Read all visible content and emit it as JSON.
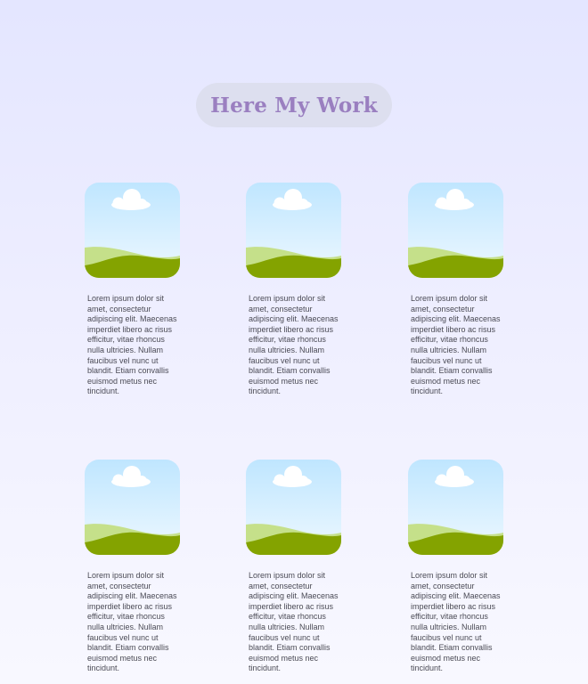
{
  "header": {
    "title": "Here My Work"
  },
  "colors": {
    "background_top": "#e4e6ff",
    "background_bottom": "#f8f8ff",
    "pill": "#dddfef",
    "title": "#9a7fc0",
    "sky_top": "#bfe6ff",
    "sky_bottom": "#eef8ff",
    "hill_light": "#c5e08a",
    "hill_dark": "#84a300",
    "cloud": "#ffffff"
  },
  "portfolio": {
    "items": [
      {
        "image_icon": "landscape-image-icon",
        "text": "Lorem ipsum dolor sit amet, consectetur adipiscing elit. Maecenas imperdiet libero ac risus efficitur, vitae rhoncus nulla ultricies. Nullam faucibus vel nunc ut blandit. Etiam convallis euismod metus nec tincidunt."
      },
      {
        "image_icon": "landscape-image-icon",
        "text": "Lorem ipsum dolor sit amet, consectetur adipiscing elit. Maecenas imperdiet libero ac risus efficitur, vitae rhoncus nulla ultricies. Nullam faucibus vel nunc ut blandit. Etiam convallis euismod metus nec tincidunt."
      },
      {
        "image_icon": "landscape-image-icon",
        "text": "Lorem ipsum dolor sit amet, consectetur adipiscing elit. Maecenas imperdiet libero ac risus efficitur, vitae rhoncus nulla ultricies. Nullam faucibus vel nunc ut blandit. Etiam convallis euismod metus nec tincidunt."
      },
      {
        "image_icon": "landscape-image-icon",
        "text": "Lorem ipsum dolor sit amet, consectetur adipiscing elit. Maecenas imperdiet libero ac risus efficitur, vitae rhoncus nulla ultricies. Nullam faucibus vel nunc ut blandit. Etiam convallis euismod metus nec tincidunt."
      },
      {
        "image_icon": "landscape-image-icon",
        "text": "Lorem ipsum dolor sit amet, consectetur adipiscing elit. Maecenas imperdiet libero ac risus efficitur, vitae rhoncus nulla ultricies. Nullam faucibus vel nunc ut blandit. Etiam convallis euismod metus nec tincidunt."
      },
      {
        "image_icon": "landscape-image-icon",
        "text": "Lorem ipsum dolor sit amet, consectetur adipiscing elit. Maecenas imperdiet libero ac risus efficitur, vitae rhoncus nulla ultricies. Nullam faucibus vel nunc ut blandit. Etiam convallis euismod metus nec tincidunt."
      }
    ]
  }
}
